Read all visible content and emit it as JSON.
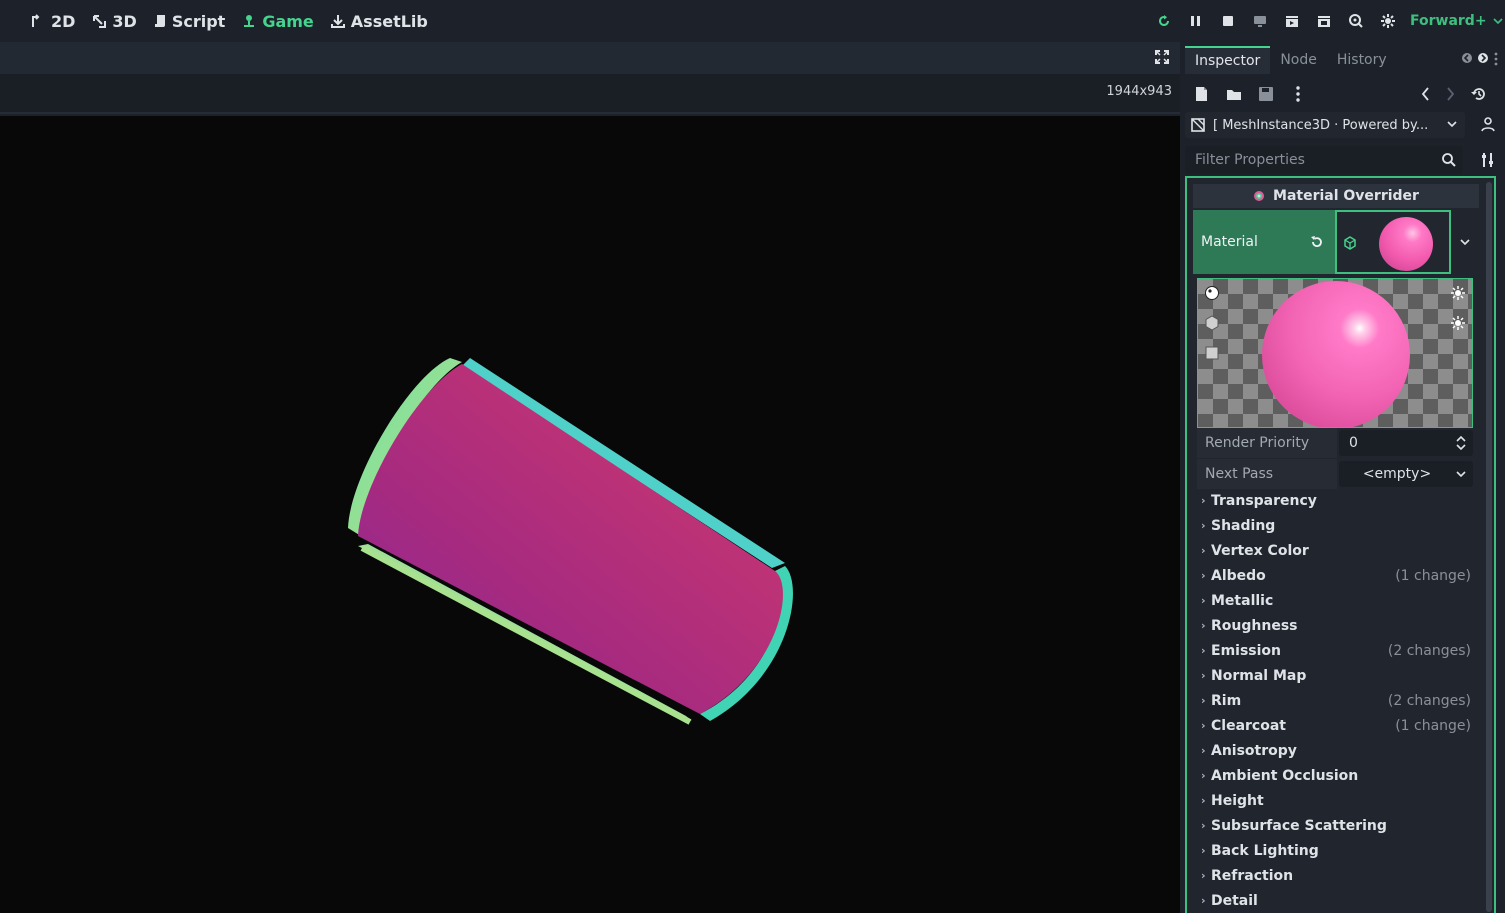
{
  "topbar": {
    "main_tabs": [
      {
        "label": "2D",
        "icon": "2d-icon"
      },
      {
        "label": "3D",
        "icon": "3d-icon"
      },
      {
        "label": "Script",
        "icon": "script-icon"
      },
      {
        "label": "Game",
        "icon": "game-icon",
        "active": true
      },
      {
        "label": "AssetLib",
        "icon": "assetlib-icon"
      }
    ],
    "renderer": "Forward+",
    "accent": "#45d48e"
  },
  "viewport": {
    "resolution": "1944x943"
  },
  "inspector": {
    "tabs": [
      "Inspector",
      "Node",
      "History"
    ],
    "node_path": "[ MeshInstance3D · Powered by...",
    "filter_placeholder": "Filter Properties",
    "section_title": "Material Overrider",
    "material_label": "Material",
    "render_priority_label": "Render Priority",
    "render_priority_value": "0",
    "next_pass_label": "Next Pass",
    "next_pass_value": "<empty>",
    "categories": [
      {
        "label": "Transparency",
        "changes": ""
      },
      {
        "label": "Shading",
        "changes": ""
      },
      {
        "label": "Vertex Color",
        "changes": ""
      },
      {
        "label": "Albedo",
        "changes": "(1 change)"
      },
      {
        "label": "Metallic",
        "changes": ""
      },
      {
        "label": "Roughness",
        "changes": ""
      },
      {
        "label": "Emission",
        "changes": "(2 changes)"
      },
      {
        "label": "Normal Map",
        "changes": ""
      },
      {
        "label": "Rim",
        "changes": "(2 changes)"
      },
      {
        "label": "Clearcoat",
        "changes": "(1 change)"
      },
      {
        "label": "Anisotropy",
        "changes": ""
      },
      {
        "label": "Ambient Occlusion",
        "changes": ""
      },
      {
        "label": "Height",
        "changes": ""
      },
      {
        "label": "Subsurface Scattering",
        "changes": ""
      },
      {
        "label": "Back Lighting",
        "changes": ""
      },
      {
        "label": "Refraction",
        "changes": ""
      },
      {
        "label": "Detail",
        "changes": ""
      }
    ]
  }
}
